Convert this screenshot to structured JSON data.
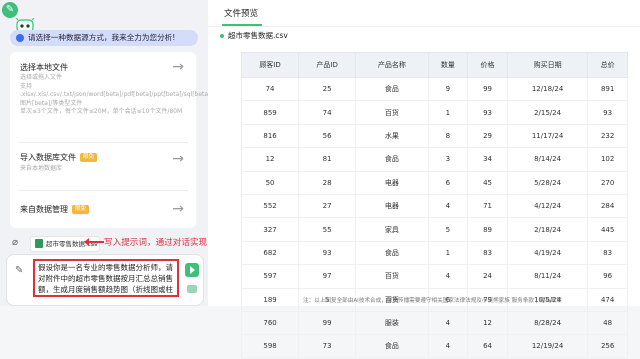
{
  "left_panel": {
    "prompt_bubble": "请选择一种数据源方式，我来全力为您分析!",
    "options": [
      {
        "title": "选择本地文件",
        "desc": "选择或拖入文件\n支持\n.xlsx/.xls/.csv/.txt/json/word[beta]/pdf[beta]/ppt[beta]/sql[beta]/图片[beta]/等类型文件\n单次≤3个文件，每个文件≤20M，单个会话≤10个文件/80M",
        "badge": ""
      },
      {
        "title": "导入数据库文件",
        "desc": "来自本地数据库",
        "badge": "限免"
      },
      {
        "title": "来自数据管理",
        "desc": "",
        "badge": "限免"
      }
    ],
    "attached_file": "超市零售数据.csv",
    "hint": "写入提示词，通过对话实现自主分析",
    "input_text": "假设你是一名专业的零售数据分析师，请对附件中的超市零售数据按月汇总总销售额，生成月度销售额趋势图（折线图或柱状"
  },
  "right_panel": {
    "tab": "文件预览",
    "file_name": "超市零售数据.csv",
    "table": {
      "headers": [
        "顾客ID",
        "产品ID",
        "产品名称",
        "数量",
        "价格",
        "购买日期",
        "总价"
      ],
      "rows": [
        [
          "74",
          "25",
          "食品",
          "9",
          "99",
          "12/18/24",
          "891"
        ],
        [
          "859",
          "74",
          "百货",
          "1",
          "93",
          "2/15/24",
          "93"
        ],
        [
          "816",
          "56",
          "水果",
          "8",
          "29",
          "11/17/24",
          "232"
        ],
        [
          "12",
          "81",
          "食品",
          "3",
          "34",
          "8/14/24",
          "102"
        ],
        [
          "50",
          "28",
          "电器",
          "6",
          "45",
          "5/28/24",
          "270"
        ],
        [
          "552",
          "27",
          "电器",
          "4",
          "71",
          "4/12/24",
          "284"
        ],
        [
          "327",
          "55",
          "家具",
          "5",
          "89",
          "2/18/24",
          "445"
        ],
        [
          "682",
          "93",
          "食品",
          "1",
          "83",
          "4/19/24",
          "83"
        ],
        [
          "597",
          "97",
          "百货",
          "4",
          "24",
          "8/11/24",
          "96"
        ],
        [
          "189",
          "5",
          "百货",
          "6",
          "79",
          "10/5/24",
          "474"
        ],
        [
          "760",
          "99",
          "服装",
          "4",
          "12",
          "8/28/24",
          "48"
        ],
        [
          "598",
          "73",
          "食品",
          "4",
          "64",
          "12/19/24",
          "256"
        ]
      ]
    },
    "footer": "注：以上回复全部由AI技术合成，聚焦传播需要遵守相关国家法律法规及小浣熊家族  服务条款 | 隐私政策"
  }
}
